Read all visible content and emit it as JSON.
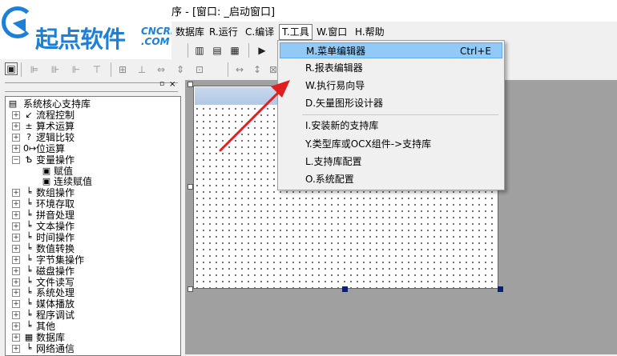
{
  "window": {
    "title": "序 - [窗口: _启动窗口]"
  },
  "logo": {
    "text_cn": "起点软件",
    "text_en_top": "CNCRK",
    "text_en_bottom": ".COM"
  },
  "menubar": {
    "items": [
      "数据库",
      "R.运行",
      "C.编译",
      "T.工具",
      "W.窗口",
      "H.帮助"
    ]
  },
  "tools_menu": {
    "items": [
      {
        "label": "M.菜单编辑器",
        "shortcut": "Ctrl+E"
      },
      {
        "label": "R.报表编辑器",
        "shortcut": ""
      },
      {
        "label": "W.执行易向导",
        "shortcut": ""
      },
      {
        "label": "D.矢量图形设计器",
        "shortcut": ""
      },
      {
        "label": "I.安装新的支持库",
        "shortcut": ""
      },
      {
        "label": "Y.类型库或OCX组件->支持库",
        "shortcut": ""
      },
      {
        "label": "L.支持库配置",
        "shortcut": ""
      },
      {
        "label": "O.系统配置",
        "shortcut": ""
      }
    ]
  },
  "left_panel": {
    "pin_symbol": "▫",
    "close_symbol": "×"
  },
  "tree": {
    "root": "系统核心支持库",
    "items": [
      {
        "label": "流程控制",
        "icon": "↙"
      },
      {
        "label": "算术运算",
        "icon": "±"
      },
      {
        "label": "逻辑比较",
        "icon": "?"
      },
      {
        "label": "位运算",
        "icon": "0↦"
      },
      {
        "label": "变量操作",
        "icon": "Ѣ"
      },
      {
        "label": "赋值",
        "icon": "▣"
      },
      {
        "label": "连续赋值",
        "icon": "▣"
      },
      {
        "label": "数组操作",
        "icon": "╘"
      },
      {
        "label": "环境存取",
        "icon": "╘"
      },
      {
        "label": "拼音处理",
        "icon": "╘"
      },
      {
        "label": "文本操作",
        "icon": "╘"
      },
      {
        "label": "时间操作",
        "icon": "╘"
      },
      {
        "label": "数值转换",
        "icon": "╘"
      },
      {
        "label": "字节集操作",
        "icon": "╘"
      },
      {
        "label": "磁盘操作",
        "icon": "╘"
      },
      {
        "label": "文件读写",
        "icon": "╘"
      },
      {
        "label": "系统处理",
        "icon": "╘"
      },
      {
        "label": "媒体播放",
        "icon": "╘"
      },
      {
        "label": "程序调试",
        "icon": "╘"
      },
      {
        "label": "其他",
        "icon": "╘"
      },
      {
        "label": "数据库",
        "icon": "▦"
      },
      {
        "label": "网络通信",
        "icon": "╘"
      }
    ]
  },
  "colors": {
    "menu_highlight": "#91c9f7",
    "arrow": "#e02020",
    "logo_blue": "#1e7fd6",
    "workspace": "#a0a0a0"
  }
}
